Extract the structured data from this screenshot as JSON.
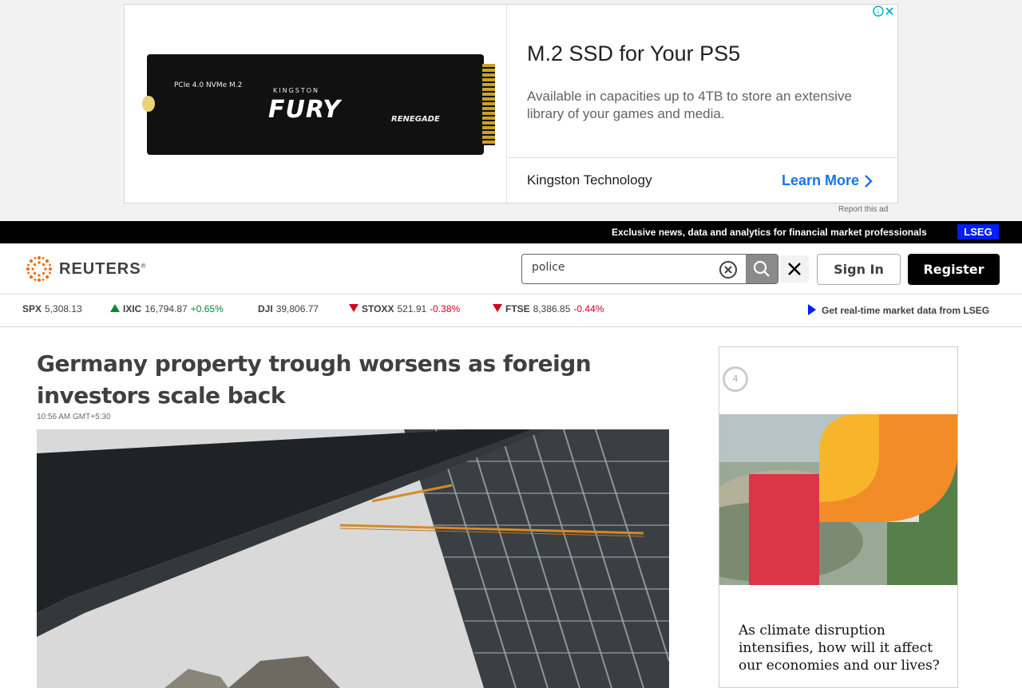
{
  "top_ad": {
    "image_labels": {
      "interface": "PCIe 4.0 NVMe M.2",
      "brand": "KINGSTON",
      "product": "FURY",
      "model": "RENEGADE"
    },
    "title": "M.2 SSD for Your PS5",
    "description": "Available in capacities up to 4TB to store an extensive library of your games and media.",
    "advertiser": "Kingston Technology",
    "cta": "Learn More",
    "report_label": "Report this ad"
  },
  "lseg_bar": {
    "text": "Exclusive news, data and analytics for financial market professionals",
    "logo": "LSEG",
    "color": "#001eff"
  },
  "header": {
    "logo_text": "REUTERS",
    "logo_mark": "®",
    "search": {
      "value": "police",
      "placeholder": ""
    },
    "sign_in": "Sign In",
    "register": "Register"
  },
  "ticker": {
    "items": [
      {
        "symbol": "SPX",
        "value": "5,308.13",
        "change": "",
        "direction": "none"
      },
      {
        "symbol": "IXIC",
        "value": "16,794.87",
        "change": "+0.65%",
        "direction": "up"
      },
      {
        "symbol": "DJI",
        "value": "39,806.77",
        "change": "",
        "direction": "none"
      },
      {
        "symbol": "STOXX",
        "value": "521.91",
        "change": "-0.38%",
        "direction": "down"
      },
      {
        "symbol": "FTSE",
        "value": "8,386.85",
        "change": "-0.44%",
        "direction": "down"
      }
    ],
    "realtime_link": "Get real-time market data from LSEG",
    "colors": {
      "up": "#008a35",
      "down": "#d6001c"
    }
  },
  "article": {
    "headline": "Germany property trough worsens as foreign investors scale back",
    "timestamp": "10:56 AM GMT+5:30"
  },
  "side_ad": {
    "badge": "4",
    "caption": "As climate disruption intensifies, how will it affect our economies and our lives?"
  }
}
